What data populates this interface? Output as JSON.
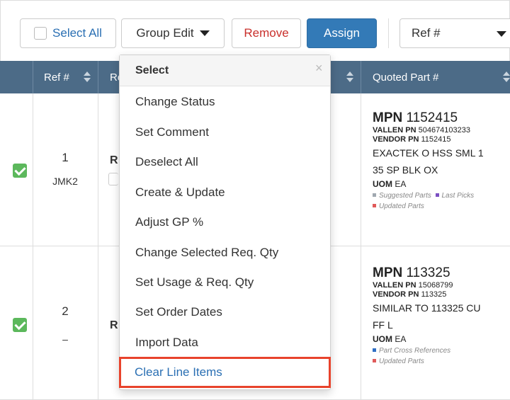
{
  "toolbar": {
    "select_all": "Select All",
    "group_edit": "Group Edit",
    "remove": "Remove",
    "assign": "Assign",
    "ref_select": "Ref #"
  },
  "table": {
    "headers": [
      "Ref #",
      "Re",
      "Quoted Part #"
    ],
    "rows": [
      {
        "checked": true,
        "ref": "1",
        "sub": "JMK2",
        "partial": "R",
        "mpn_label": "MPN",
        "mpn": "1152415",
        "vallen_label": "VALLEN PN",
        "vallen": "504674103233",
        "vendor_label": "VENDOR PN",
        "vendor": "1152415",
        "desc1": "EXACTEK O HSS SML 1",
        "desc2": "35 SP BLK OX",
        "uom_label": "UOM",
        "uom": "EA",
        "legend1": "Suggested Parts",
        "legend2": "Last Picks",
        "legend3": "Updated Parts"
      },
      {
        "checked": true,
        "ref": "2",
        "sub": "–",
        "partial": "R",
        "mpn_label": "MPN",
        "mpn": "113325",
        "vallen_label": "VALLEN PN",
        "vallen": "15068799",
        "vendor_label": "VENDOR PN",
        "vendor": "113325",
        "desc1": "SIMILAR TO 113325 CU",
        "desc2": "FF L",
        "uom_label": "UOM",
        "uom": "EA",
        "legend1": "Part Cross References",
        "legend2": "Updated Parts"
      }
    ]
  },
  "dropdown": {
    "title": "Select",
    "close": "×",
    "items": [
      "Change Status",
      "Set Comment",
      "Deselect All",
      "Create & Update",
      "Adjust GP %",
      "Change Selected Req. Qty",
      "Set Usage & Req. Qty",
      "Set Order Dates",
      "Import Data",
      "Clear Line Items"
    ]
  },
  "colors": {
    "header_bg": "#4c6b87",
    "primary": "#337ab7",
    "danger": "#c9302c",
    "success": "#5cb85c",
    "highlight_border": "#e8432c",
    "legend_gray": "#a0a8b0",
    "legend_purple": "#7b4fc2",
    "legend_red": "#e05a5a",
    "legend_blue": "#2f6fc4"
  }
}
